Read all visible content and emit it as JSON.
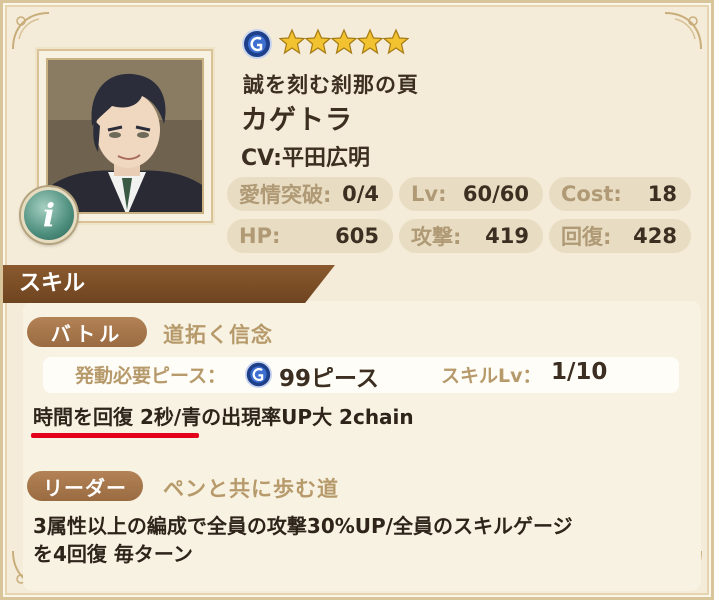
{
  "character": {
    "title": "誠を刻む刹那の頁",
    "name": "カゲトラ",
    "cv": "CV:平田広明",
    "rarity": 5
  },
  "stats": {
    "affection_label": "愛情突破:",
    "affection_value": "0/4",
    "lv_label": "Lv:",
    "lv_value": "60/60",
    "cost_label": "Cost:",
    "cost_value": "18",
    "hp_label": "HP:",
    "hp_value": "605",
    "attack_label": "攻撃:",
    "attack_value": "419",
    "heal_label": "回復:",
    "heal_value": "428"
  },
  "section": {
    "skill_header": "スキル"
  },
  "battle_skill": {
    "tag": "バトル",
    "name": "道拓く信念",
    "required_label": "発動必要ピース：",
    "required_value": "99ピース",
    "level_label": "スキルLv：",
    "level_value": "1/10",
    "description": "時間を回復 2秒/青の出現率UP大 2chain"
  },
  "leader_skill": {
    "tag": "リーダー",
    "name": "ペンと共に歩む道",
    "description_line1": "3属性以上の編成で全員の攻撃30%UP/全員のスキルゲージ",
    "description_line2": "を4回復 毎ターン"
  },
  "icons": {
    "attribute": "blue-attribute-orb-icon",
    "info": "info-icon",
    "star": "star-icon"
  },
  "colors": {
    "accent_brown": "#8a5a2e",
    "label_tan": "#b79a6b",
    "highlight_red": "#e3001b",
    "attribute_blue": "#2f5fc4",
    "star_gold": "#f2c230"
  }
}
